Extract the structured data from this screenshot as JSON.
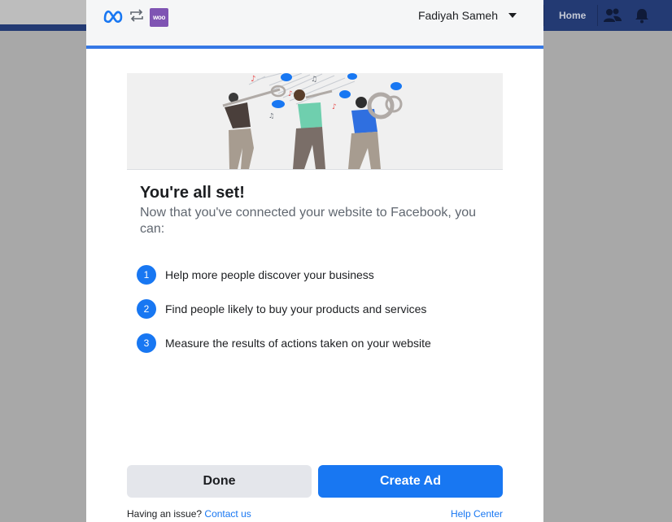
{
  "background": {
    "nav_home": "Home"
  },
  "header": {
    "woo_logo_text": "woo",
    "account_name": "Fadiyah Sameh"
  },
  "main": {
    "title": "You're all set!",
    "subtitle": "Now that you've connected your website to Facebook, you can:",
    "steps": [
      {
        "number": "1",
        "text": "Help more people discover your business"
      },
      {
        "number": "2",
        "text": "Find people likely to buy your products and services"
      },
      {
        "number": "3",
        "text": "Measure the results of actions taken on your website"
      }
    ]
  },
  "actions": {
    "done_label": "Done",
    "create_ad_label": "Create Ad"
  },
  "footer": {
    "issue_text": "Having an issue?",
    "contact_link": "Contact us",
    "help_link": "Help Center"
  },
  "colors": {
    "primary": "#1877f2",
    "header_border": "#3578e5",
    "woo_purple": "#7f54b3"
  }
}
